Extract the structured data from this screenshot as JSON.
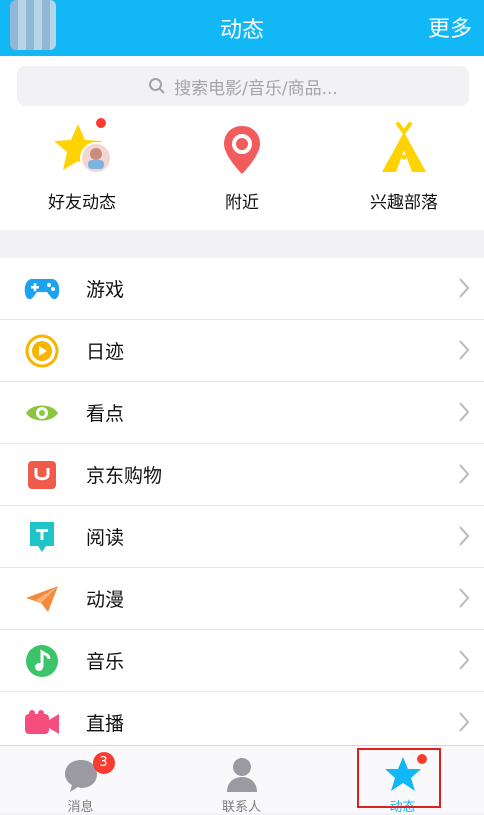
{
  "header": {
    "title": "动态",
    "more_label": "更多"
  },
  "search": {
    "placeholder": "搜索电影/音乐/商品..."
  },
  "quick": [
    {
      "label": "好友动态",
      "icon": "qzone-star-icon"
    },
    {
      "label": "附近",
      "icon": "location-pin-icon"
    },
    {
      "label": "兴趣部落",
      "icon": "tent-icon"
    }
  ],
  "items": [
    {
      "label": "游戏",
      "icon": "gamepad-icon",
      "color": "#1aa3f0"
    },
    {
      "label": "日迹",
      "icon": "play-circle-icon",
      "color": "#f7b500"
    },
    {
      "label": "看点",
      "icon": "eye-icon",
      "color": "#8cc63f"
    },
    {
      "label": "京东购物",
      "icon": "shopping-bag-icon",
      "color": "#f05a4a"
    },
    {
      "label": "阅读",
      "icon": "book-icon",
      "color": "#1fc3c8"
    },
    {
      "label": "动漫",
      "icon": "paper-plane-icon",
      "color": "#f58a3a"
    },
    {
      "label": "音乐",
      "icon": "music-note-icon",
      "color": "#3bc46a"
    },
    {
      "label": "直播",
      "icon": "video-camera-icon",
      "color": "#f54d7d"
    }
  ],
  "tabs": [
    {
      "label": "消息",
      "badge": "3",
      "icon": "chat-bubble-icon"
    },
    {
      "label": "联系人",
      "icon": "contact-person-icon"
    },
    {
      "label": "动态",
      "icon": "star-icon",
      "active": true
    }
  ],
  "colors": {
    "brand": "#12b7f5",
    "badge": "#fa3b2f",
    "highlight": "#e02020"
  }
}
